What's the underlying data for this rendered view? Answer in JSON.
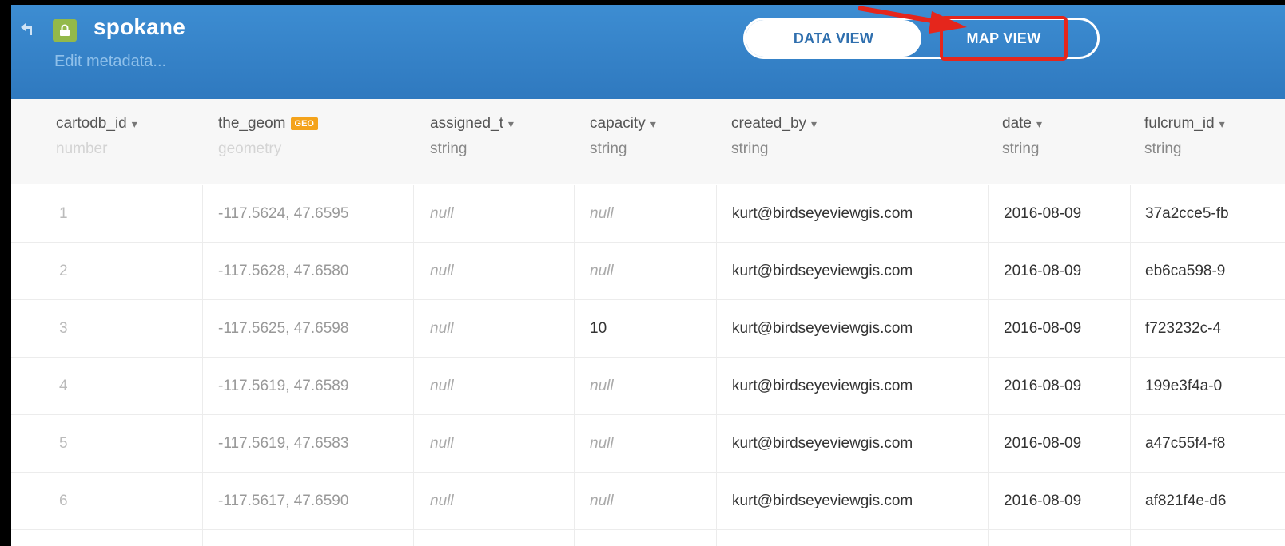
{
  "header": {
    "title": "spokane",
    "subtitle": "Edit metadata...",
    "tabs": [
      {
        "label": "DATA VIEW",
        "active": true
      },
      {
        "label": "MAP VIEW",
        "active": false
      }
    ],
    "colors": {
      "bar": "#2f79bf",
      "accent_green": "#93b94a",
      "highlight": "#e5261c"
    }
  },
  "table": {
    "columns": [
      {
        "name": "cartodb_id",
        "type": "number"
      },
      {
        "name": "the_geom",
        "type": "geometry",
        "badge": "GEO"
      },
      {
        "name": "assigned_t",
        "type": "string"
      },
      {
        "name": "capacity",
        "type": "string"
      },
      {
        "name": "created_by",
        "type": "string"
      },
      {
        "name": "date",
        "type": "string"
      },
      {
        "name": "fulcrum_id",
        "type": "string"
      }
    ],
    "rows": [
      {
        "cartodb_id": "1",
        "the_geom": "-117.5624, 47.6595",
        "assigned_t": "null",
        "capacity": "null",
        "created_by": "kurt@birdseyeviewgis.com",
        "date": "2016-08-09",
        "fulcrum_id": "37a2cce5-fb"
      },
      {
        "cartodb_id": "2",
        "the_geom": "-117.5628, 47.6580",
        "assigned_t": "null",
        "capacity": "null",
        "created_by": "kurt@birdseyeviewgis.com",
        "date": "2016-08-09",
        "fulcrum_id": "eb6ca598-9"
      },
      {
        "cartodb_id": "3",
        "the_geom": "-117.5625, 47.6598",
        "assigned_t": "null",
        "capacity": "10",
        "created_by": "kurt@birdseyeviewgis.com",
        "date": "2016-08-09",
        "fulcrum_id": "f723232c-4"
      },
      {
        "cartodb_id": "4",
        "the_geom": "-117.5619, 47.6589",
        "assigned_t": "null",
        "capacity": "null",
        "created_by": "kurt@birdseyeviewgis.com",
        "date": "2016-08-09",
        "fulcrum_id": "199e3f4a-0"
      },
      {
        "cartodb_id": "5",
        "the_geom": "-117.5619, 47.6583",
        "assigned_t": "null",
        "capacity": "null",
        "created_by": "kurt@birdseyeviewgis.com",
        "date": "2016-08-09",
        "fulcrum_id": "a47c55f4-f8"
      },
      {
        "cartodb_id": "6",
        "the_geom": "-117.5617, 47.6590",
        "assigned_t": "null",
        "capacity": "null",
        "created_by": "kurt@birdseyeviewgis.com",
        "date": "2016-08-09",
        "fulcrum_id": "af821f4e-d6"
      }
    ]
  }
}
